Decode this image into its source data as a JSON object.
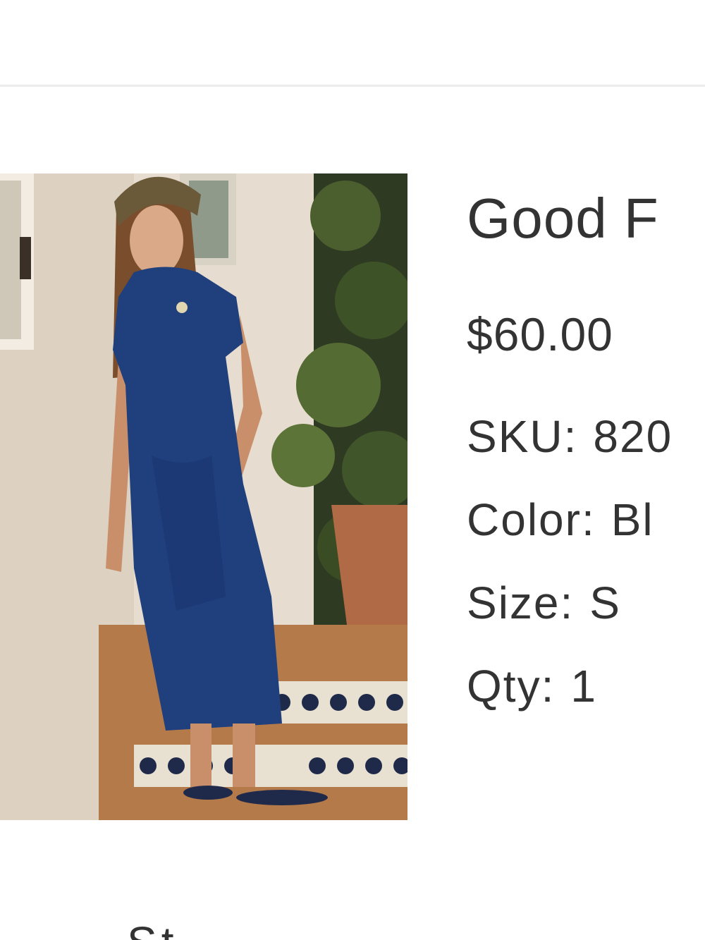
{
  "product": {
    "title": "Good F",
    "price": "$60.00",
    "sku_label": "SKU:",
    "sku_value": "820",
    "color_label": "Color:",
    "color_value": "Bl",
    "size_label": "Size:",
    "size_value": "S",
    "qty_label": "Qty:",
    "qty_value": "1",
    "image_icon": "product-photo-blue-maxi-dress"
  },
  "footer": {
    "partial_text": "St"
  },
  "colors": {
    "dress": "#1f3f7d",
    "wall": "#e8ddd0",
    "text": "#333333",
    "divider": "#ececec"
  }
}
